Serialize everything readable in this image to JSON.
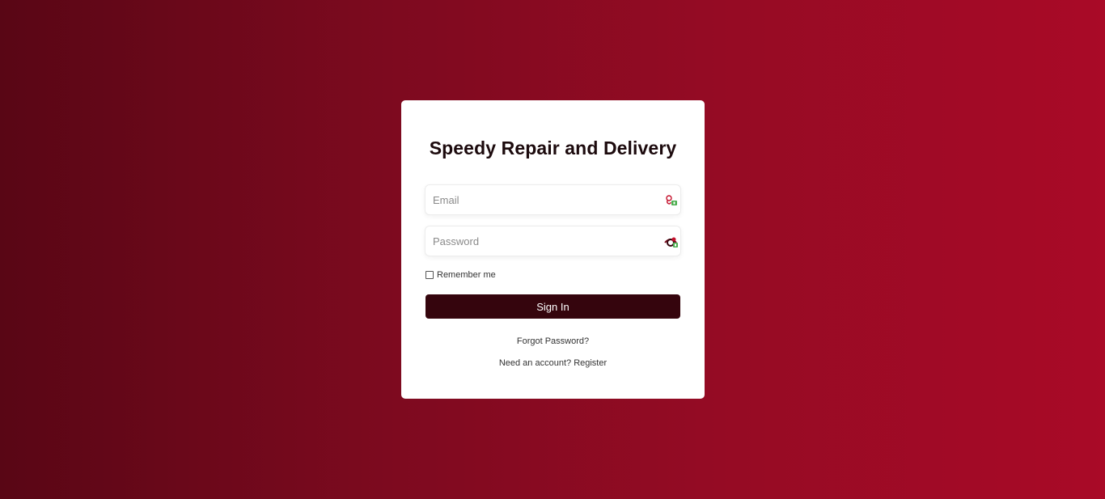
{
  "login": {
    "title": "Speedy Repair and Delivery",
    "email_placeholder": "Email",
    "password_placeholder": "Password",
    "remember_label": "Remember me",
    "signin_label": "Sign In",
    "forgot_label": "Forgot Password?",
    "register_prompt": "Need an account?",
    "register_link": "Register"
  },
  "colors": {
    "background_start": "#590615",
    "background_end": "#a90a27",
    "button": "#35050d",
    "card": "#ffffff"
  },
  "icons": {
    "email_field": "password-manager-key-icon",
    "password_field": "password-manager-eye-icon"
  }
}
